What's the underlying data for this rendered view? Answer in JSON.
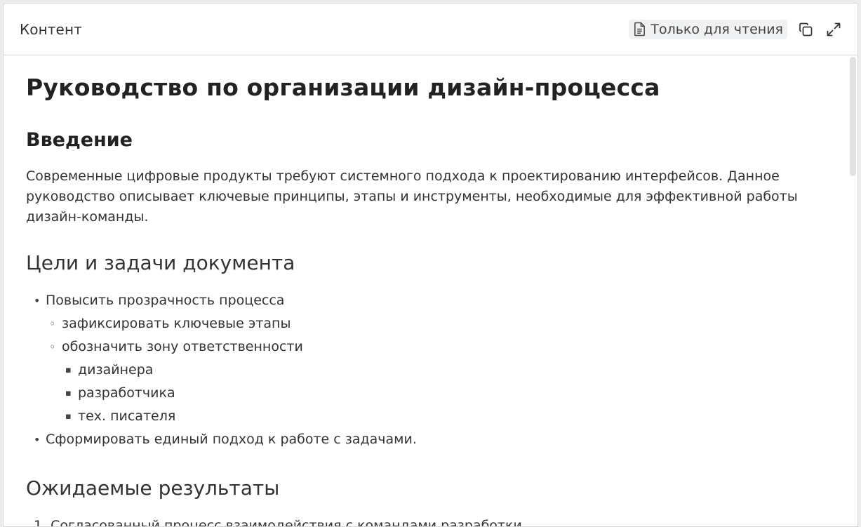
{
  "panel": {
    "title": "Контент",
    "readonly_label": "Только для чтения",
    "icons": {
      "readonly": "document-icon",
      "copy": "copy-icon",
      "expand": "expand-icon"
    }
  },
  "document": {
    "title": "Руководство по организации дизайн-процесса",
    "intro_heading": "Введение",
    "intro_text": "Современные цифровые продукты требуют системного подхода к проектированию интерфейсов. Данное руководство описывает ключевые принципы, этапы и инструменты, необходимые для эффективной работы дизайн-команды.",
    "goals_heading": "Цели и задачи документа",
    "goals": [
      {
        "text": "Повысить прозрачность процесса",
        "children": [
          {
            "text": "зафиксировать ключевые этапы"
          },
          {
            "text": "обозначить зону ответственности",
            "children": [
              "дизайнера",
              "разработчика",
              "тех. писателя"
            ]
          }
        ]
      },
      {
        "text": "Сформировать единый подход к работе с задачами."
      }
    ],
    "results_heading": "Ожидаемые результаты",
    "results": [
      "1. Согласованный процесс взаимодействия с командами разработки"
    ]
  }
}
